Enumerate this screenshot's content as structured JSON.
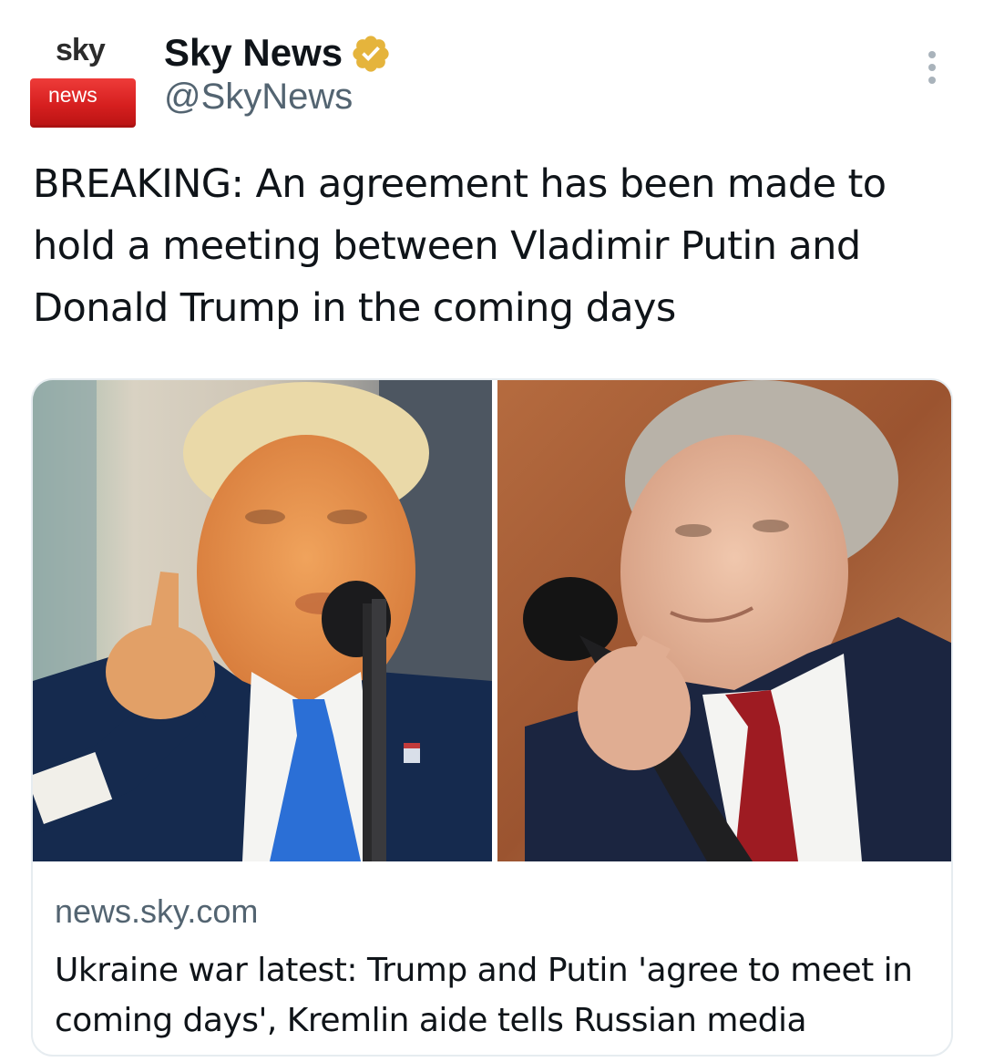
{
  "author": {
    "avatar": {
      "logo_top": "sky",
      "logo_bottom": "news"
    },
    "display_name": "Sky News",
    "verified_icon": "verified-badge-icon",
    "handle": "@SkyNews"
  },
  "more_icon": "more-options-icon",
  "tweet": {
    "text": "BREAKING: An agreement has been made to hold a meeting between Vladimir Putin and Donald Trump in the coming days"
  },
  "link_card": {
    "domain": "news.sky.com",
    "title": "Ukraine war latest: Trump and Putin 'agree to meet in coming days', Kremlin aide tells Russian media"
  },
  "colors": {
    "verified_badge": "#e5b43c",
    "brand_red": "#d61f1f",
    "text_secondary": "#536471",
    "border": "#e6ecf0"
  }
}
